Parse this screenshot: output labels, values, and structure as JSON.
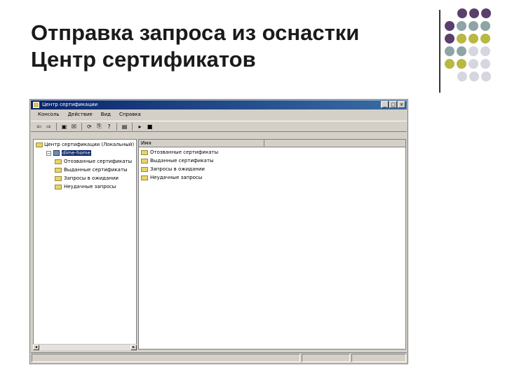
{
  "slide": {
    "title_line1": "Отправка запроса из оснастки",
    "title_line2": "Центр сертификатов",
    "colors": {
      "purple": "#5b3f6b",
      "teal": "#8fa5a5",
      "olive": "#b9b842",
      "lightgray": "#d6d6df"
    }
  },
  "window": {
    "title": "Центр сертификации",
    "icon": "certificate-app-icon",
    "buttons": {
      "minimize": "_",
      "maximize": "□",
      "close": "×"
    },
    "menu": [
      "Консоль",
      "Действие",
      "Вид",
      "Справка"
    ],
    "toolbar_icons": [
      "back-arrow-icon",
      "forward-arrow-icon",
      "folder-up-icon",
      "properties-icon",
      "refresh-icon",
      "export-icon",
      "help-icon",
      "console-tree-icon",
      "start-service-icon",
      "stop-service-icon"
    ],
    "tree": {
      "root_label": "Центр сертификации (Локальный)",
      "ca_node": "dime-home",
      "children": [
        "Отозванные сертификаты",
        "Выданные сертификаты",
        "Запросы в ожидании",
        "Неудачные запросы"
      ]
    },
    "list": {
      "column_name": "Имя",
      "items": [
        "Отозванные сертификаты",
        "Выданные сертификаты",
        "Запросы в ожидании",
        "Неудачные запросы"
      ]
    }
  }
}
